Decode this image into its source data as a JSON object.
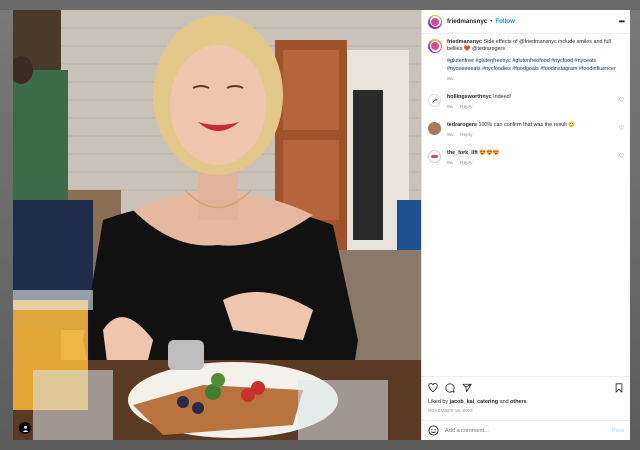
{
  "post": {
    "author": "friedmansnyc",
    "follow_label": "Follow",
    "caption_text": "Side effects of @friedmansnyc include smiles and full bellies ❤️ @tedrarogers",
    "hashtags": "#glutenfree #glutenfreenyc #glutenfreefood #nycfood #nyceats #nyceeeeeats #nycfoodies #foodgoals #foodinstagram #foodinfluencer",
    "caption_time": "9w"
  },
  "comments": [
    {
      "user": "hollingsworthnyc",
      "text": "Indeed!",
      "time": "9w",
      "reply": "Reply"
    },
    {
      "user": "tedrarogers",
      "text": "100% can confirm that was the result 🙂",
      "time": "9w",
      "reply": "Reply"
    },
    {
      "user": "the_fork_lift",
      "text": "😍😍😍",
      "time": "9w",
      "reply": "Reply"
    }
  ],
  "likes": {
    "prefix": "Liked by ",
    "user": "jacob_kai_catering",
    "conj": " and ",
    "others": "others"
  },
  "date": "NOVEMBER 18, 2022",
  "composer": {
    "placeholder": "Add a comment...",
    "post_label": "Post"
  },
  "icons": [
    "heart-icon",
    "comment-icon",
    "share-icon",
    "bookmark-icon",
    "emoji-icon",
    "more-icon",
    "user-tag-icon"
  ],
  "colors": {
    "follow": "#0095f6",
    "post_disabled": "#b3dbff",
    "link": "#00376b"
  }
}
